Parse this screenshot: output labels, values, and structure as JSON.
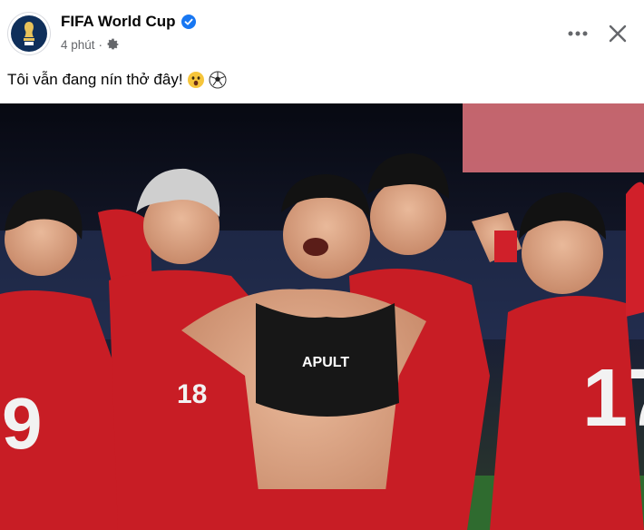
{
  "post": {
    "page_name": "FIFA World Cup",
    "time": "4 phút",
    "separator": "·",
    "caption": "Tôi vẫn đang nín thở đây!",
    "icons": {
      "avatar": "fifa-world-cup-logo",
      "verified": "verified-badge-icon",
      "privacy": "gear-icon",
      "more": "more-options-icon",
      "close": "close-icon",
      "emoji1": "astonished-face-emoji",
      "emoji2": "soccer-ball-emoji"
    },
    "colors": {
      "verified": "#1877f2",
      "kit_red": "#d0202a",
      "text": "#050505",
      "secondary": "#65676b"
    }
  },
  "photo": {
    "description_icon": "team-celebration-photo",
    "jersey_numbers": [
      "9",
      "18",
      "17"
    ],
    "sponsor_text": "APULT"
  }
}
